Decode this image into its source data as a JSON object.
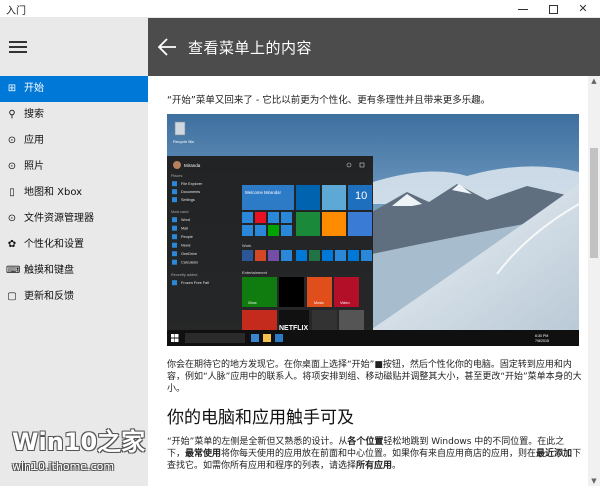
{
  "window": {
    "title": "入门",
    "minimize_label": "—",
    "close_label": "✕"
  },
  "sidebar": {
    "items": [
      {
        "label": "开始",
        "icon": "home-icon",
        "glyph": "⊞",
        "active": true
      },
      {
        "label": "搜索",
        "icon": "search-icon",
        "glyph": "⚲",
        "active": false
      },
      {
        "label": "应用",
        "icon": "apps-icon",
        "glyph": "⊙",
        "active": false
      },
      {
        "label": "照片",
        "icon": "photos-icon",
        "glyph": "⊙",
        "active": false
      },
      {
        "label": "地图和 Xbox",
        "icon": "map-icon",
        "glyph": "▯",
        "active": false
      },
      {
        "label": "文件资源管理器",
        "icon": "explorer-icon",
        "glyph": "⊙",
        "active": false
      },
      {
        "label": "个性化和设置",
        "icon": "palette-icon",
        "glyph": "✿",
        "active": false
      },
      {
        "label": "触摸和键盘",
        "icon": "keyboard-icon",
        "glyph": "⌨",
        "active": false
      },
      {
        "label": "更新和反馈",
        "icon": "feedback-icon",
        "glyph": "▢",
        "active": false
      }
    ]
  },
  "header": {
    "title": "查看菜单上的内容"
  },
  "content": {
    "intro": "“开始”菜单又回来了 - 它比以前更为个性化、更有条理性并且带来更多乐趣。",
    "para1": "你会在期待它的地方发现它。在你桌面上选择“开始”■按钮，然后个性化你的电脑。固定转到应用和内容，例如“人脉”应用中的联系人。将项安排到组、移动磁贴并调整其大小，甚至更改“开始”菜单本身的大小。",
    "heading": "你的电脑和应用触手可及",
    "para2_parts": [
      "“开始”菜单的左侧是全新但又熟悉的设计。从",
      "各个位置",
      "轻松地跳到 Windows 中的不同位置。在此之下，",
      "最常使用",
      "将你每天使用的应用放在前面和中心位置。如果你有来自应用商店的应用，则在",
      "最近添加",
      "下查找它。如需你所有应用和程序的列表，请选择",
      "所有应用",
      "。"
    ]
  },
  "screenshot": {
    "user_name": "Miranda",
    "places_header": "Places",
    "places": [
      "File Explorer",
      "Documents",
      "Settings"
    ],
    "most_used_header": "Most used",
    "most_used": [
      "Word",
      "Mail",
      "People",
      "News",
      "OneDrive",
      "Calculator"
    ],
    "recently_added_header": "Recently added",
    "recently_added": [
      "Frozen Free Fall"
    ],
    "life_tile_text": "Welcome Miranda!",
    "date_number": "10",
    "work_header": "Work",
    "entertainment_header": "Entertainment",
    "tile_labels": [
      "Xbox",
      "Music",
      "Video"
    ],
    "netflix_label": "NETFLIX",
    "recycle_label": "Recycle Bin",
    "clock_text": "6:30 PM",
    "date_text": "7/8/2015"
  },
  "watermark": {
    "brand": "Win10之家",
    "url": "win10.ithome.com"
  },
  "colors": {
    "accent": "#0078d7",
    "header_bg": "#4c4c4c",
    "sidebar_bg": "#e9e9e9"
  }
}
